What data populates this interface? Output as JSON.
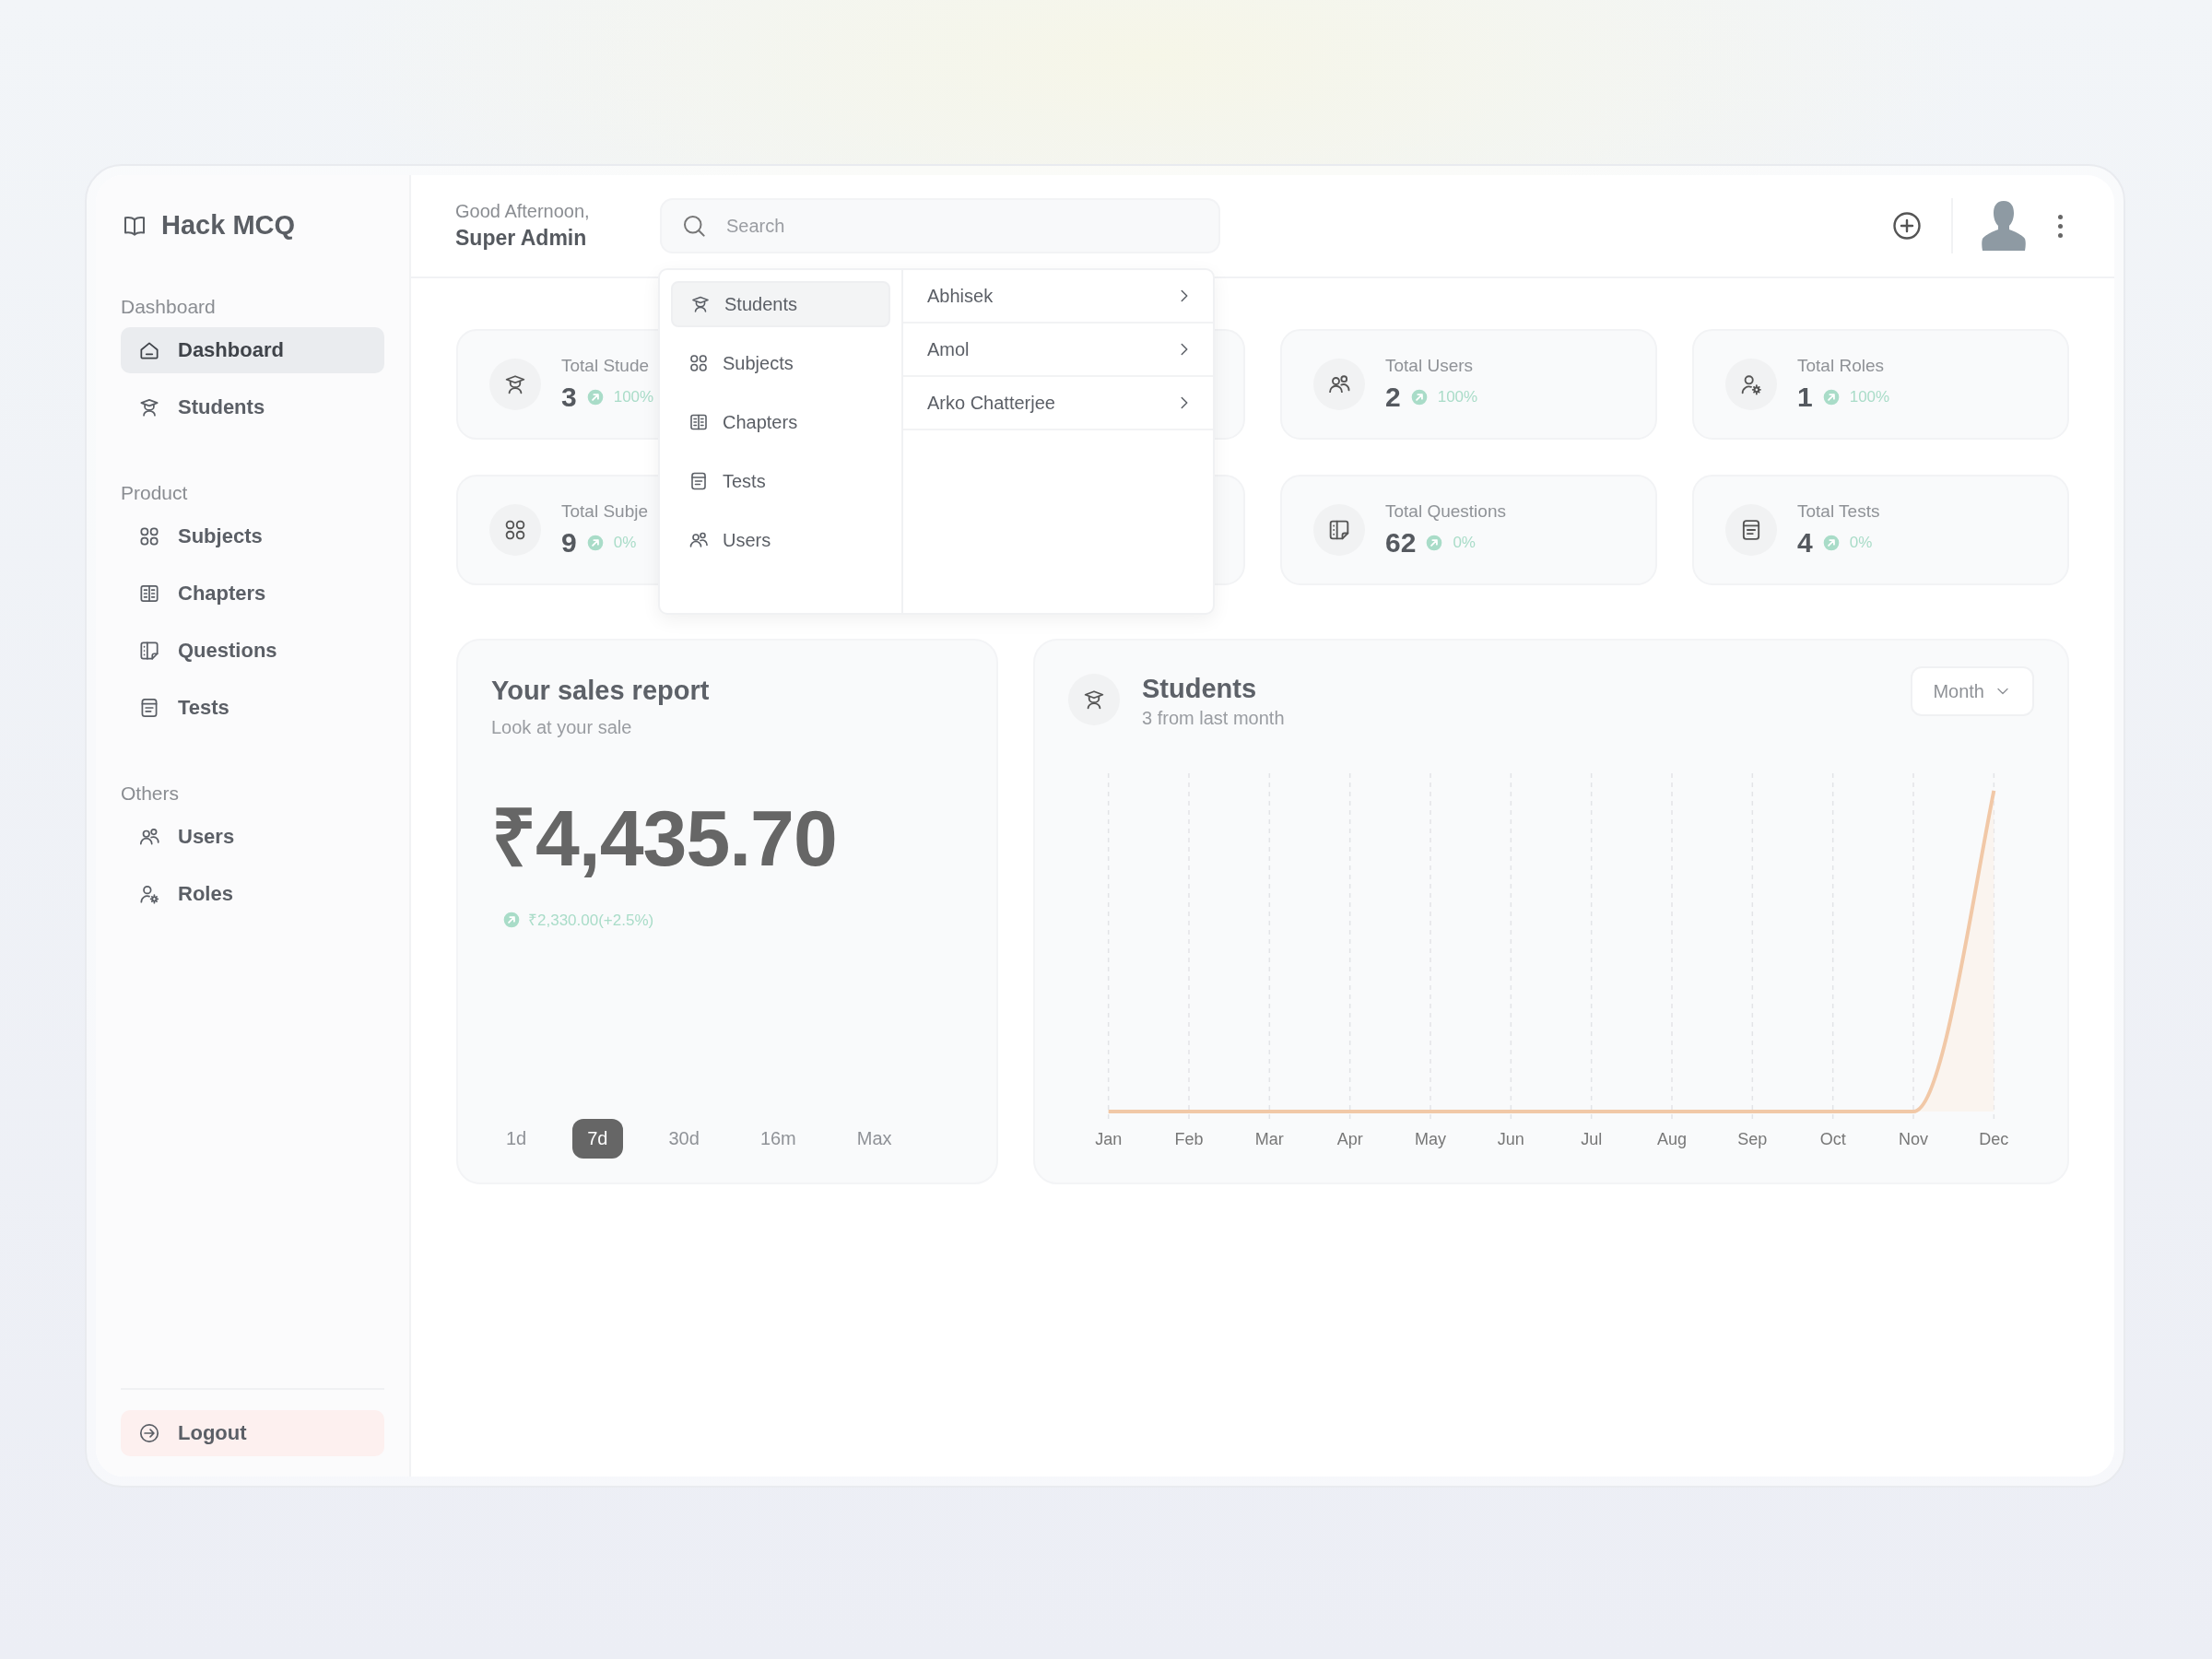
{
  "brand": {
    "name": "Hack MCQ"
  },
  "sidebar": {
    "sections": [
      {
        "title": "Dashboard",
        "items": [
          {
            "label": "Dashboard",
            "selected": true
          },
          {
            "label": "Students",
            "selected": false
          }
        ]
      },
      {
        "title": "Product",
        "items": [
          {
            "label": "Subjects",
            "selected": false
          },
          {
            "label": "Chapters",
            "selected": false
          },
          {
            "label": "Questions",
            "selected": false
          },
          {
            "label": "Tests",
            "selected": false
          }
        ]
      },
      {
        "title": "Others",
        "items": [
          {
            "label": "Users",
            "selected": false
          },
          {
            "label": "Roles",
            "selected": false
          }
        ]
      }
    ],
    "logout": "Logout"
  },
  "header": {
    "greeting": "Good Afternoon,",
    "user": "Super Admin",
    "search": {
      "placeholder": "Search"
    }
  },
  "search_dropdown": {
    "categories": [
      {
        "label": "Students",
        "selected": true
      },
      {
        "label": "Subjects",
        "selected": false
      },
      {
        "label": "Chapters",
        "selected": false
      },
      {
        "label": "Tests",
        "selected": false
      },
      {
        "label": "Users",
        "selected": false
      }
    ],
    "results": [
      "Abhisek",
      "Amol",
      "Arko Chatterjee"
    ]
  },
  "stats": [
    {
      "kind": "stat",
      "label": "Total Stude",
      "value": "3",
      "change": "100%"
    },
    {
      "kind": "covered"
    },
    {
      "kind": "stat",
      "label": "Total Users",
      "value": "2",
      "change": "100%"
    },
    {
      "kind": "stat",
      "label": "Total Roles",
      "value": "1",
      "change": "100%"
    },
    {
      "kind": "stat",
      "label": "Total Subje",
      "value": "9",
      "change": "0%"
    },
    {
      "kind": "covered"
    },
    {
      "kind": "stat",
      "label": "Total Questions",
      "value": "62",
      "change": "0%"
    },
    {
      "kind": "stat",
      "label": "Total Tests",
      "value": "4",
      "change": "0%"
    }
  ],
  "sales_report": {
    "title": "Your sales report",
    "subtitle": "Look at your sale",
    "amount": "₹4,435.70",
    "change": "₹2,330.00(+2.5%)",
    "periods": [
      {
        "label": "1d",
        "selected": false
      },
      {
        "label": "7d",
        "selected": true
      },
      {
        "label": "30d",
        "selected": false
      },
      {
        "label": "16m",
        "selected": false
      },
      {
        "label": "Max",
        "selected": false
      }
    ]
  },
  "students_chart": {
    "title": "Students",
    "subtitle": "3 from last month",
    "period_select": "Month",
    "x_labels": [
      "Jan",
      "Feb",
      "Mar",
      "Apr",
      "May",
      "Jun",
      "Jul",
      "Aug",
      "Sep",
      "Oct",
      "Nov",
      "Dec"
    ]
  }
}
